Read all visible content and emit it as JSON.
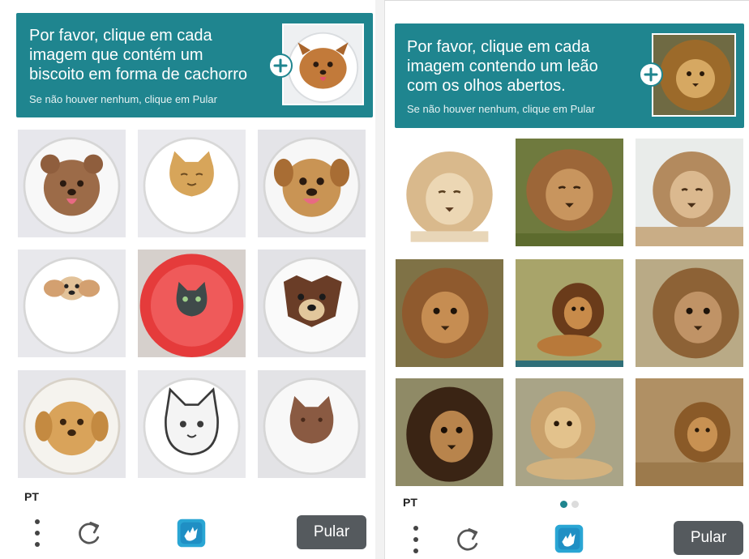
{
  "left": {
    "prompt_lines": [
      "Por favor, clique em cada",
      "imagem que contém um",
      "biscoito em forma de cachorro"
    ],
    "subtext": "Se não houver nenhum, clique em Pular",
    "sample_icon": "dog-cookie-sample",
    "tiles": [
      "dog-cookie-image",
      "cat-cookie-image",
      "dog-cookie-image",
      "dog-cookie-image",
      "cat-cookie-image",
      "dog-cookie-image",
      "dog-cookie-image",
      "cat-cookie-image",
      "cat-cookie-image"
    ],
    "language": "PT",
    "skip_label": "Pular"
  },
  "right": {
    "prompt_lines": [
      "Por favor, clique em cada",
      "imagem contendo um leão",
      "com os olhos abertos."
    ],
    "subtext": "Se não houver nenhum, clique em Pular",
    "sample_icon": "lion-sample",
    "tiles": [
      "lion-image",
      "lion-image",
      "lion-image",
      "lion-image",
      "lion-image",
      "lion-image",
      "lion-image",
      "lion-image",
      "lion-image"
    ],
    "language": "PT",
    "skip_label": "Pular",
    "pagination": {
      "current": 1,
      "total": 2
    }
  },
  "colors": {
    "header": "#1f858f",
    "skip_button": "#555a5e",
    "active_dot": "#1f858f",
    "inactive_dot": "#dcdcdc"
  },
  "icons": [
    "plus-icon",
    "menu-dots-icon",
    "refresh-icon",
    "hcaptcha-logo-icon"
  ]
}
